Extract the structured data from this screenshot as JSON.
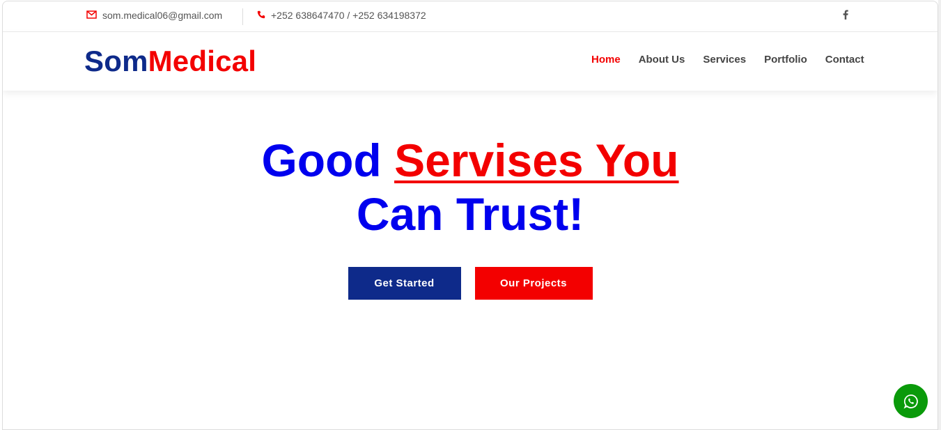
{
  "topbar": {
    "email": "som.medical06@gmail.com",
    "phone": "+252 638647470 / +252 634198372",
    "email_icon": "envelope-icon",
    "phone_icon": "phone-icon",
    "social_icon": "facebook-icon"
  },
  "logo": {
    "part1": "Som",
    "part2": "Medical"
  },
  "nav": {
    "items": [
      "Home",
      "About Us",
      "Services",
      "Portfolio",
      "Contact"
    ],
    "active": "Home"
  },
  "hero": {
    "line1_plain": "Good ",
    "line1_highlight": "Servises You",
    "line2": "Can Trust!"
  },
  "buttons": {
    "primary": "Get Started",
    "secondary": "Our Projects"
  },
  "floating": {
    "icon": "whatsapp-icon"
  },
  "colors": {
    "brand_blue": "#0e2a8a",
    "brand_red": "#f30000",
    "hero_blue": "#0000ee",
    "whatsapp_green": "#0a9a0a"
  }
}
